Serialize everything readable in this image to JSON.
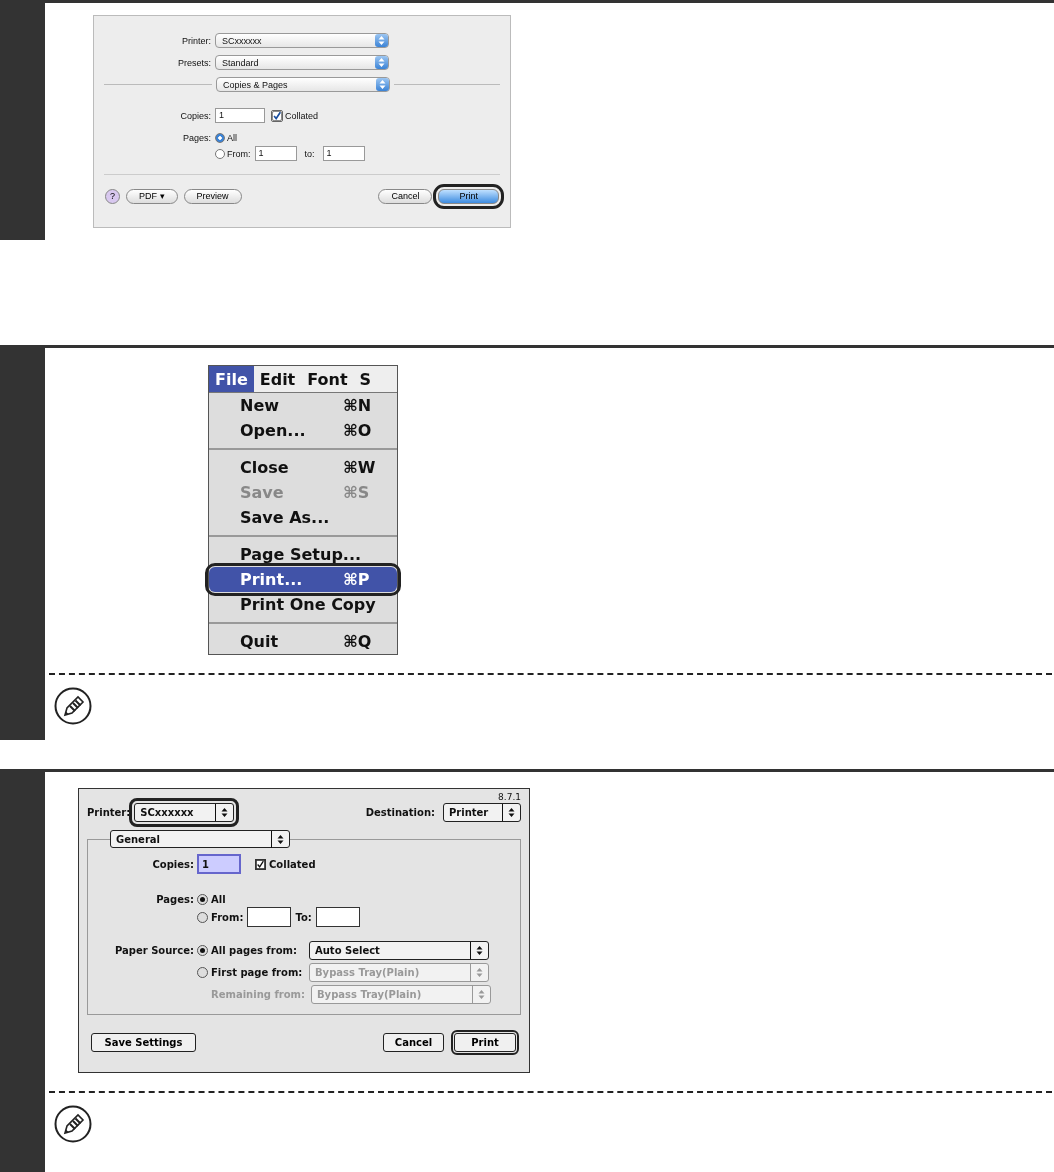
{
  "sections": [
    {
      "kind": "osx_dialog",
      "note": false,
      "dialog": {
        "printer": {
          "label": "Printer:",
          "value": "SCxxxxxx"
        },
        "presets": {
          "label": "Presets:",
          "value": "Standard"
        },
        "panel": {
          "value": "Copies & Pages"
        },
        "copies": {
          "label": "Copies:",
          "value": "1"
        },
        "collated": {
          "label": "Collated",
          "checked": true
        },
        "pages": {
          "label": "Pages:",
          "options": [
            {
              "label": "All",
              "selected": true
            },
            {
              "label": "From:",
              "selected": false
            }
          ],
          "from": "1",
          "to_label": "to:",
          "to": "1"
        },
        "buttons_left": [
          {
            "kind": "help",
            "label": "?",
            "highlighted": false
          },
          {
            "kind": "normal",
            "label": "PDF ▾",
            "highlighted": false
          },
          {
            "kind": "normal",
            "label": "Preview",
            "highlighted": false
          }
        ],
        "buttons_right": [
          {
            "kind": "normal",
            "label": "Cancel",
            "highlighted": false
          },
          {
            "kind": "default",
            "label": "Print",
            "highlighted": true
          }
        ]
      }
    },
    {
      "kind": "menu",
      "note": true,
      "menu": {
        "bar": [
          {
            "label": "File",
            "selected": true
          },
          {
            "label": "Edit",
            "selected": false
          },
          {
            "label": "Font",
            "selected": false
          },
          {
            "label": "S",
            "selected": false
          }
        ],
        "items": [
          {
            "kind": "item",
            "label": "New",
            "shortcut": "⌘N",
            "disabled": false,
            "selected": false,
            "highlighted": false
          },
          {
            "kind": "item",
            "label": "Open...",
            "shortcut": "⌘O",
            "disabled": false,
            "selected": false,
            "highlighted": false
          },
          {
            "kind": "separator"
          },
          {
            "kind": "item",
            "label": "Close",
            "shortcut": "⌘W",
            "disabled": false,
            "selected": false,
            "highlighted": false
          },
          {
            "kind": "item",
            "label": "Save",
            "shortcut": "⌘S",
            "disabled": true,
            "selected": false,
            "highlighted": false
          },
          {
            "kind": "item",
            "label": "Save As...",
            "disabled": false,
            "selected": false,
            "highlighted": false
          },
          {
            "kind": "separator"
          },
          {
            "kind": "item",
            "label": "Page Setup...",
            "disabled": false,
            "selected": false,
            "highlighted": false
          },
          {
            "kind": "item",
            "label": "Print...",
            "shortcut": "⌘P",
            "disabled": false,
            "selected": true,
            "highlighted": true
          },
          {
            "kind": "item",
            "label": "Print One Copy",
            "disabled": false,
            "selected": false,
            "highlighted": false
          },
          {
            "kind": "separator"
          },
          {
            "kind": "item",
            "label": "Quit",
            "shortcut": "⌘Q",
            "disabled": false,
            "selected": false,
            "highlighted": false
          }
        ]
      }
    },
    {
      "kind": "os9_dialog",
      "note": true,
      "dialog": {
        "version": "8.7.1",
        "printer": {
          "label": "Printer:",
          "value": "SCxxxxxx",
          "highlighted": true
        },
        "destination": {
          "label": "Destination:",
          "value": "Printer"
        },
        "panel": {
          "value": "General"
        },
        "copies": {
          "label": "Copies:",
          "value": "1",
          "focused": true
        },
        "collated": {
          "label": "Collated",
          "checked": true
        },
        "pages": {
          "label": "Pages:",
          "options": [
            {
              "label": "All",
              "selected": true
            },
            {
              "label": "From:",
              "selected": false
            }
          ],
          "to_label": "To:"
        },
        "paper_source": {
          "label": "Paper Source:",
          "options": [
            {
              "label": "All pages from:",
              "selected": true,
              "value": "Auto Select",
              "disabled": false
            },
            {
              "label": "First page from:",
              "selected": false,
              "value": "Bypass Tray(Plain)",
              "disabled": true
            }
          ],
          "remaining": {
            "label": "Remaining from:",
            "value": "Bypass Tray(Plain)",
            "disabled": true
          }
        },
        "buttons_left": [
          {
            "kind": "normal",
            "label": "Save Settings"
          }
        ],
        "buttons_right": [
          {
            "kind": "normal",
            "label": "Cancel"
          },
          {
            "kind": "default",
            "label": "Print"
          }
        ]
      }
    }
  ]
}
